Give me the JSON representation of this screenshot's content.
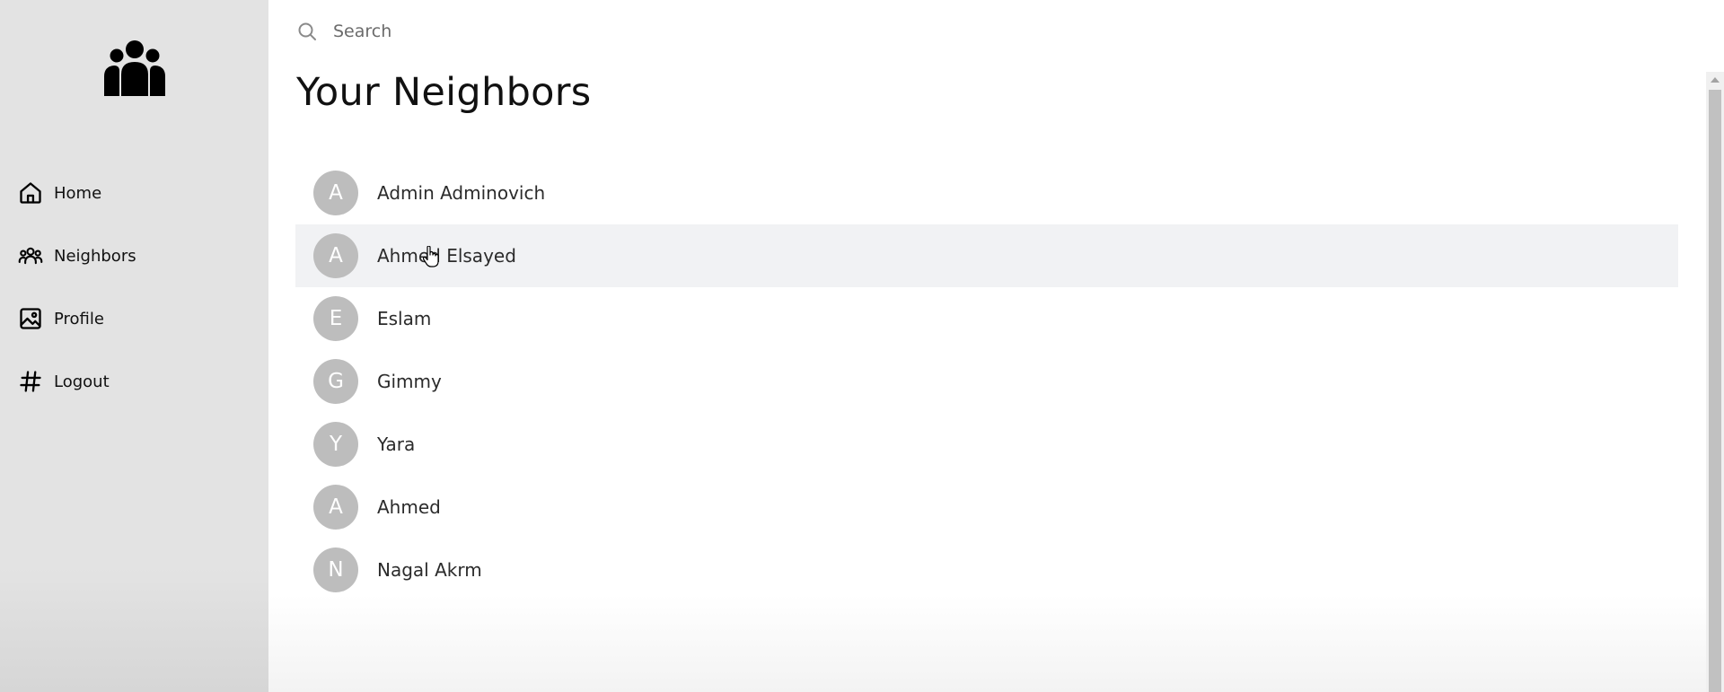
{
  "sidebar": {
    "logo_icon": "users-group-icon",
    "items": [
      {
        "label": "Home",
        "icon": "home-icon"
      },
      {
        "label": "Neighbors",
        "icon": "users-icon"
      },
      {
        "label": "Profile",
        "icon": "image-icon"
      },
      {
        "label": "Logout",
        "icon": "hash-icon"
      }
    ]
  },
  "search": {
    "placeholder": "Search",
    "value": "",
    "icon": "search-icon"
  },
  "main": {
    "title": "Your Neighbors",
    "neighbors": [
      {
        "initial": "A",
        "name": "Admin Adminovich"
      },
      {
        "initial": "A",
        "name": "Ahmed Elsayed"
      },
      {
        "initial": "E",
        "name": "Eslam"
      },
      {
        "initial": "G",
        "name": "Gimmy"
      },
      {
        "initial": "Y",
        "name": "Yara"
      },
      {
        "initial": "A",
        "name": "Ahmed"
      },
      {
        "initial": "N",
        "name": "Nagal Akrm"
      }
    ],
    "hovered_index": 1
  },
  "colors": {
    "sidebar_bg": "#e3e3e3",
    "avatar_bg": "#bdbdbd",
    "hover_row_bg": "#f1f2f4",
    "text": "#111111"
  }
}
